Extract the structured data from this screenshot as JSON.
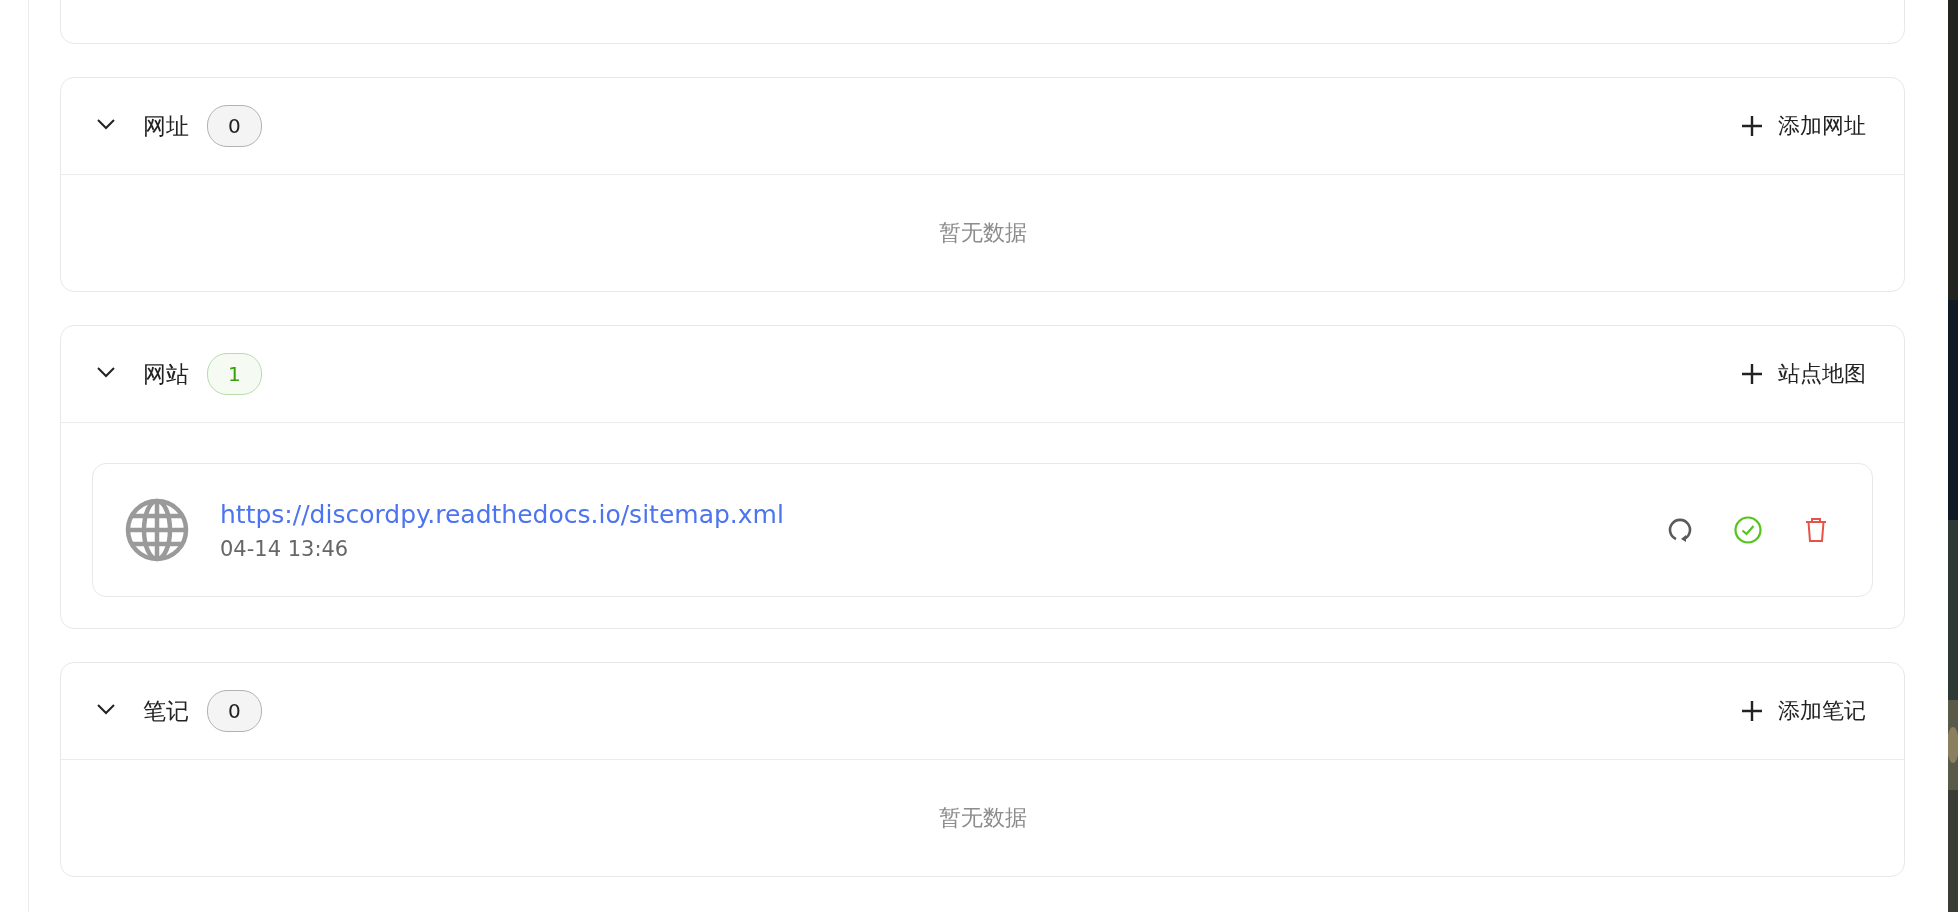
{
  "sections": [
    {
      "title": "网址",
      "count": "0",
      "color": "#222222",
      "expanded": true,
      "action": "添加网址",
      "empty_text": "暂无数据"
    },
    {
      "title": "网站",
      "count": "1",
      "color": "#389e0d",
      "expanded": true,
      "action": "站点地图",
      "items": [
        {
          "url": "https://discordpy.readthedocs.io/sitemap.xml",
          "time": "04-14 13:46"
        }
      ]
    },
    {
      "title": "笔记",
      "count": "0",
      "color": "#222222",
      "expanded": true,
      "action": "添加笔记",
      "empty_text": "暂无数据"
    }
  ]
}
